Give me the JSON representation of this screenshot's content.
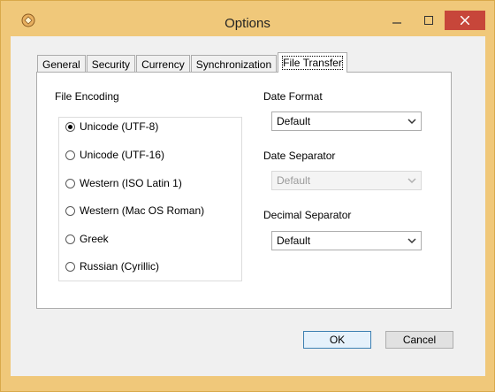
{
  "window": {
    "title": "Options",
    "icon": "app-icon",
    "controls": {
      "minimize": "minimize-icon",
      "maximize": "maximize-icon",
      "close": "close-icon"
    }
  },
  "tabs": [
    {
      "label": "General",
      "active": false
    },
    {
      "label": "Security",
      "active": false
    },
    {
      "label": "Currency",
      "active": false
    },
    {
      "label": "Synchronization",
      "active": false
    },
    {
      "label": "File Transfer",
      "active": true
    }
  ],
  "file_encoding": {
    "label": "File Encoding",
    "options": [
      {
        "label": "Unicode (UTF-8)",
        "checked": true
      },
      {
        "label": "Unicode (UTF-16)",
        "checked": false
      },
      {
        "label": "Western (ISO Latin 1)",
        "checked": false
      },
      {
        "label": "Western (Mac OS Roman)",
        "checked": false
      },
      {
        "label": "Greek",
        "checked": false
      },
      {
        "label": "Russian (Cyrillic)",
        "checked": false
      }
    ]
  },
  "date_format": {
    "label": "Date Format",
    "value": "Default",
    "enabled": true
  },
  "date_separator": {
    "label": "Date Separator",
    "value": "Default",
    "enabled": false
  },
  "decimal_separator": {
    "label": "Decimal Separator",
    "value": "Default",
    "enabled": true
  },
  "buttons": {
    "ok": "OK",
    "cancel": "Cancel"
  },
  "colors": {
    "frame": "#f0c87a",
    "close_button": "#c7463a",
    "client": "#f0f0f0"
  }
}
